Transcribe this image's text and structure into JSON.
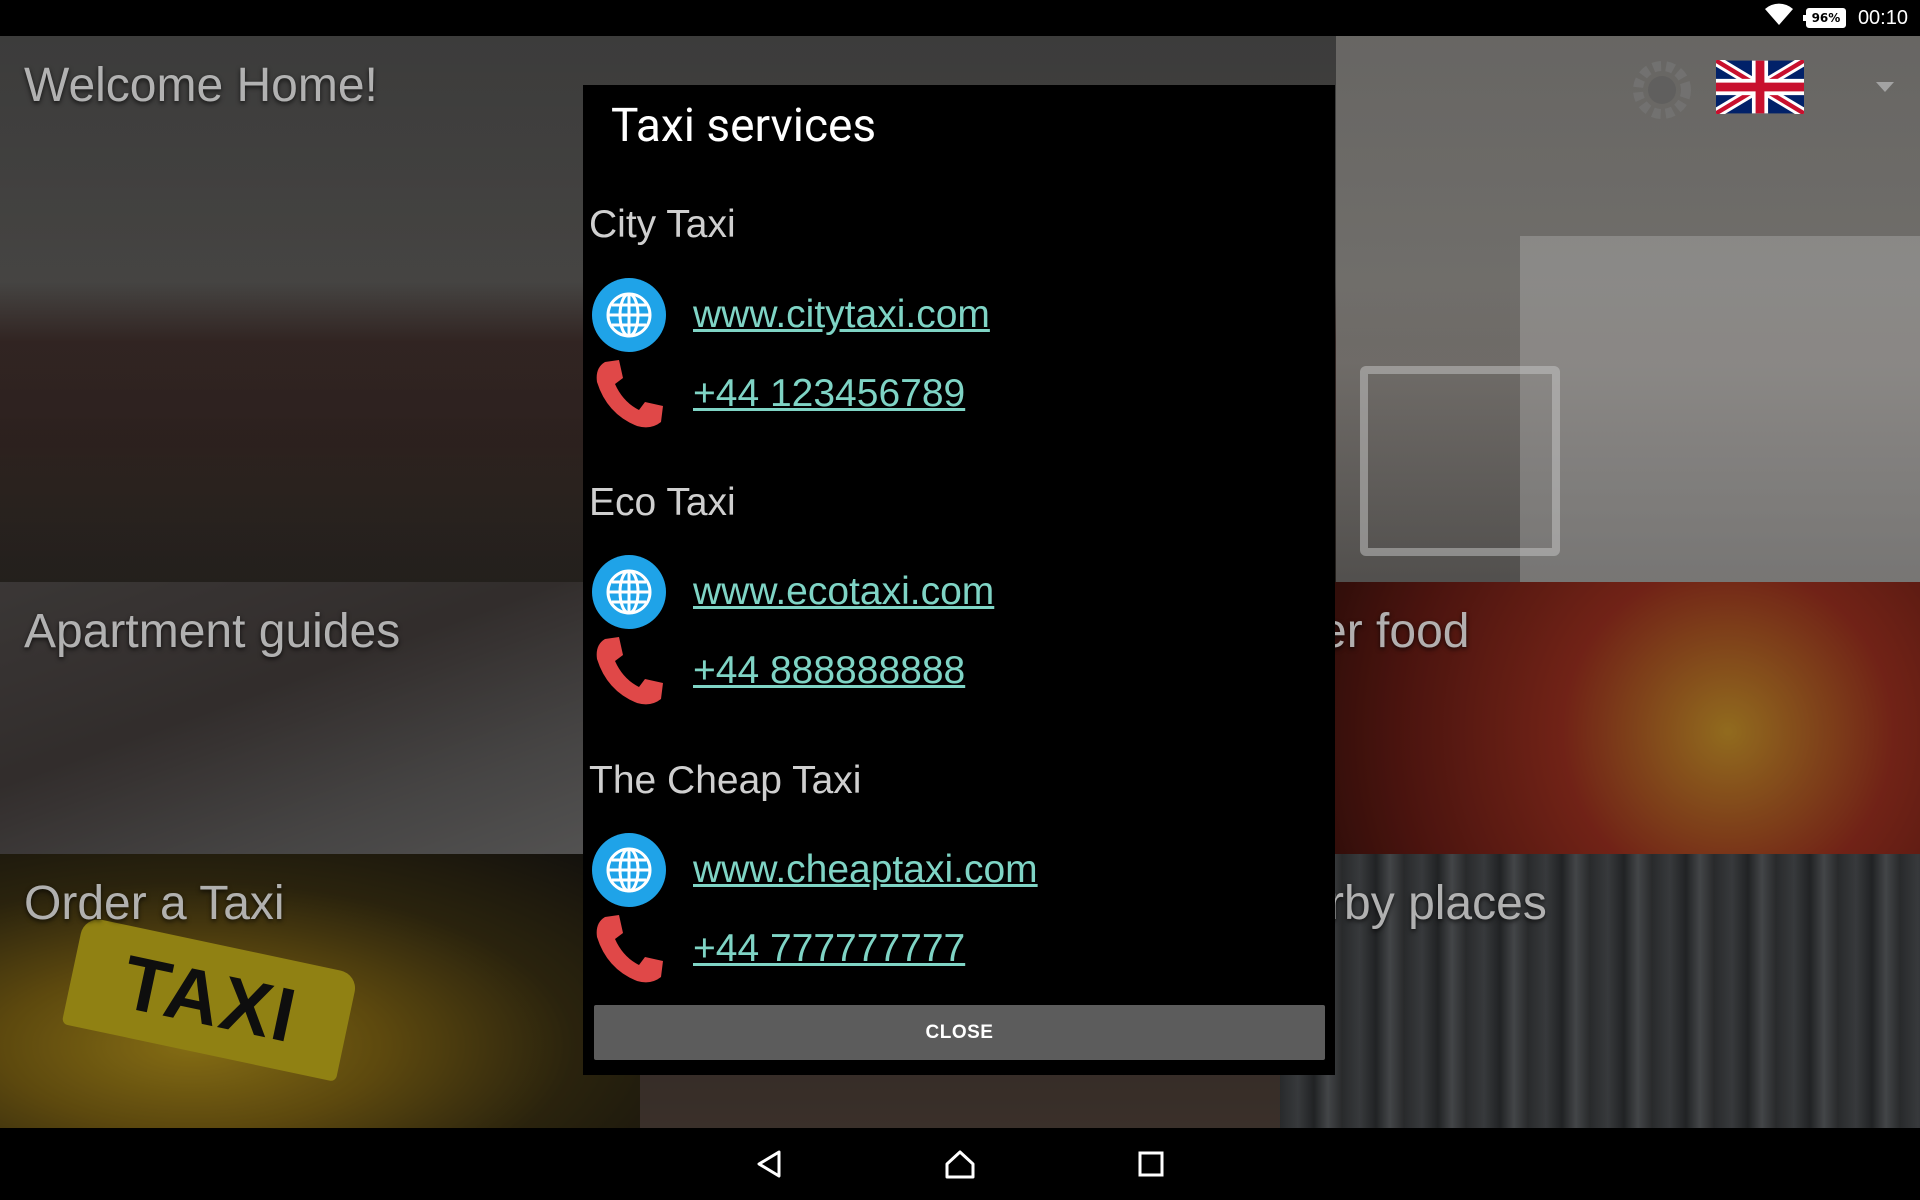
{
  "status_bar": {
    "battery": "96%",
    "time": "00:10",
    "wifi_icon": "wifi-icon"
  },
  "app": {
    "tiles": {
      "welcome": "Welcome Home!",
      "guides": "Apartment guides",
      "food": "Order food",
      "taxi": "Order a Taxi",
      "places": "Nearby places"
    },
    "settings_icon": "settings-icon",
    "language_flag": "uk-flag-icon"
  },
  "dialog": {
    "title": "Taxi services",
    "services": [
      {
        "name": "City Taxi",
        "website": "www.citytaxi.com",
        "phone": "+44 123456789"
      },
      {
        "name": "Eco Taxi",
        "website": "www.ecotaxi.com",
        "phone": "+44 888888888"
      },
      {
        "name": "The Cheap Taxi",
        "website": "www.cheaptaxi.com",
        "phone": "+44 777777777"
      }
    ],
    "close_label": "CLOSE"
  },
  "nav_bar": {
    "back": "back-icon",
    "home": "home-icon",
    "recents": "recents-icon"
  },
  "colors": {
    "link": "#7fd4c5",
    "globe": "#1fa3e8",
    "phone": "#e04848",
    "dialog_bg": "#000000",
    "button_bg": "#5c5c5c"
  }
}
